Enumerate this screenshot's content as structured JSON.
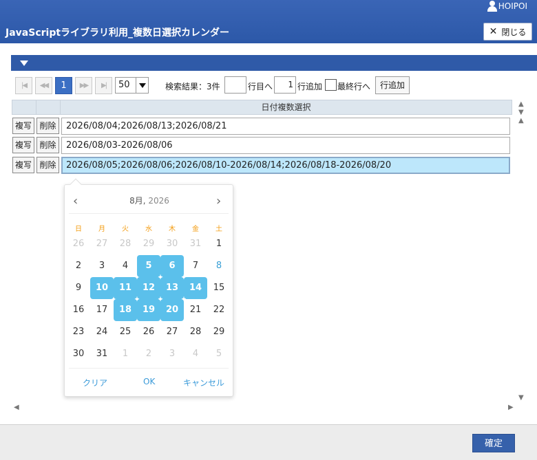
{
  "header": {
    "user": "HOIPOI",
    "title": "JavaScriptライブラリ利用_複数日選択カレンダー",
    "close_label": "閉じる"
  },
  "pager": {
    "current_page": "1",
    "page_size": "50",
    "result_text": "検索結果：3件",
    "row_input_value": "",
    "row_to_label": "行目へ",
    "add_count": "1",
    "add_rows_label": "行追加",
    "last_row_label": "最終行へ",
    "add_button_label": "行追加"
  },
  "grid": {
    "column_header": "日付複数選択",
    "copy_label": "複写",
    "delete_label": "削除",
    "rows": [
      {
        "value": "2026/08/04;2026/08/13;2026/08/21"
      },
      {
        "value": "2026/08/03-2026/08/06"
      },
      {
        "value": "2026/08/05;2026/08/06;2026/08/10-2026/08/14;2026/08/18-2026/08/20"
      }
    ]
  },
  "calendar": {
    "month_label": "8月,",
    "year_label": "2026",
    "prev_icon": "chevron-left-icon",
    "next_icon": "chevron-right-icon",
    "weekdays": [
      "日",
      "月",
      "火",
      "水",
      "木",
      "金",
      "土"
    ],
    "weeks": [
      [
        "26",
        "27",
        "28",
        "29",
        "30",
        "31",
        "1"
      ],
      [
        "2",
        "3",
        "4",
        "5",
        "6",
        "7",
        "8"
      ],
      [
        "9",
        "10",
        "11",
        "12",
        "13",
        "14",
        "15"
      ],
      [
        "16",
        "17",
        "18",
        "19",
        "20",
        "21",
        "22"
      ],
      [
        "23",
        "24",
        "25",
        "26",
        "27",
        "28",
        "29"
      ],
      [
        "30",
        "31",
        "1",
        "2",
        "3",
        "4",
        "5"
      ]
    ],
    "selected_days": [
      "5",
      "6",
      "10",
      "11",
      "12",
      "13",
      "14",
      "18",
      "19",
      "20"
    ],
    "clear_label": "クリア",
    "ok_label": "OK",
    "cancel_label": "キャンセル"
  },
  "footer": {
    "confirm_label": "確定"
  },
  "colors": {
    "header": "#2f5aa8",
    "selected_day": "#5bc0eb",
    "active_cell": "#bde7fb",
    "weekday_header": "#f39c12"
  }
}
